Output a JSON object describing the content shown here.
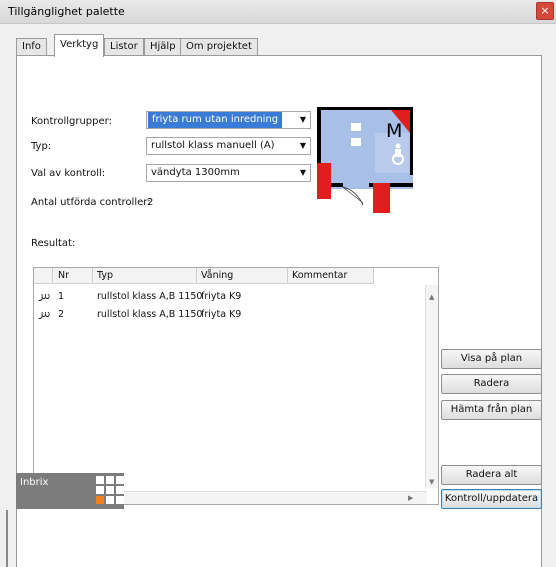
{
  "window": {
    "title": "Tillgänglighet palette",
    "close_glyph": "×"
  },
  "tabs": [
    {
      "label": "Info"
    },
    {
      "label": "Verktyg"
    },
    {
      "label": "Listor"
    },
    {
      "label": "Hjälp"
    },
    {
      "label": "Om projektet"
    }
  ],
  "form": {
    "kontrollgrupper_label": "Kontrollgrupper:",
    "kontrollgrupper_value": "friyta rum utan inredning",
    "typ_label": "Typ:",
    "typ_value": "rullstol klass manuell (A)",
    "val_label": "Val av kontroll:",
    "val_value": "vändyta 1300mm",
    "antal_label": "Antal utförda controller:",
    "antal_value": "2",
    "resultat_label": "Resultat:",
    "dropdown_glyph": "▼"
  },
  "preview": {
    "letter": "M",
    "icon": "wheelchair-icon"
  },
  "table": {
    "columns": [
      "Nr",
      "Typ",
      "Våning",
      "Kommentar"
    ],
    "rows": [
      {
        "icon": "curl-icon",
        "glyph": "൰",
        "nr": "1",
        "typ": "rullstol klass A,B 1150",
        "vaning": "friyta K9",
        "kommentar": ""
      },
      {
        "icon": "curl-icon",
        "glyph": "൰",
        "nr": "2",
        "typ": "rullstol klass A,B 1150",
        "vaning": "friyta K9",
        "kommentar": ""
      }
    ],
    "scroll_up": "▲",
    "scroll_down": "▼",
    "scroll_left": "◀",
    "scroll_right": "▶"
  },
  "buttons": {
    "visa_pa_plan": "Visa på plan",
    "radera": "Radera",
    "hamta_fran_plan": "Hämta från plan",
    "radera_alt": "Radera alt",
    "kontroll_uppdatera": "Kontroll/uppdatera"
  },
  "logo": {
    "text": "Inbrix"
  },
  "colors": {
    "selection": "#3a7bd5",
    "preview_wall": "#e01e1e",
    "preview_floor": "#a8bfe8",
    "logo_bg": "#7c7c7c",
    "logo_accent": "#f08020"
  }
}
